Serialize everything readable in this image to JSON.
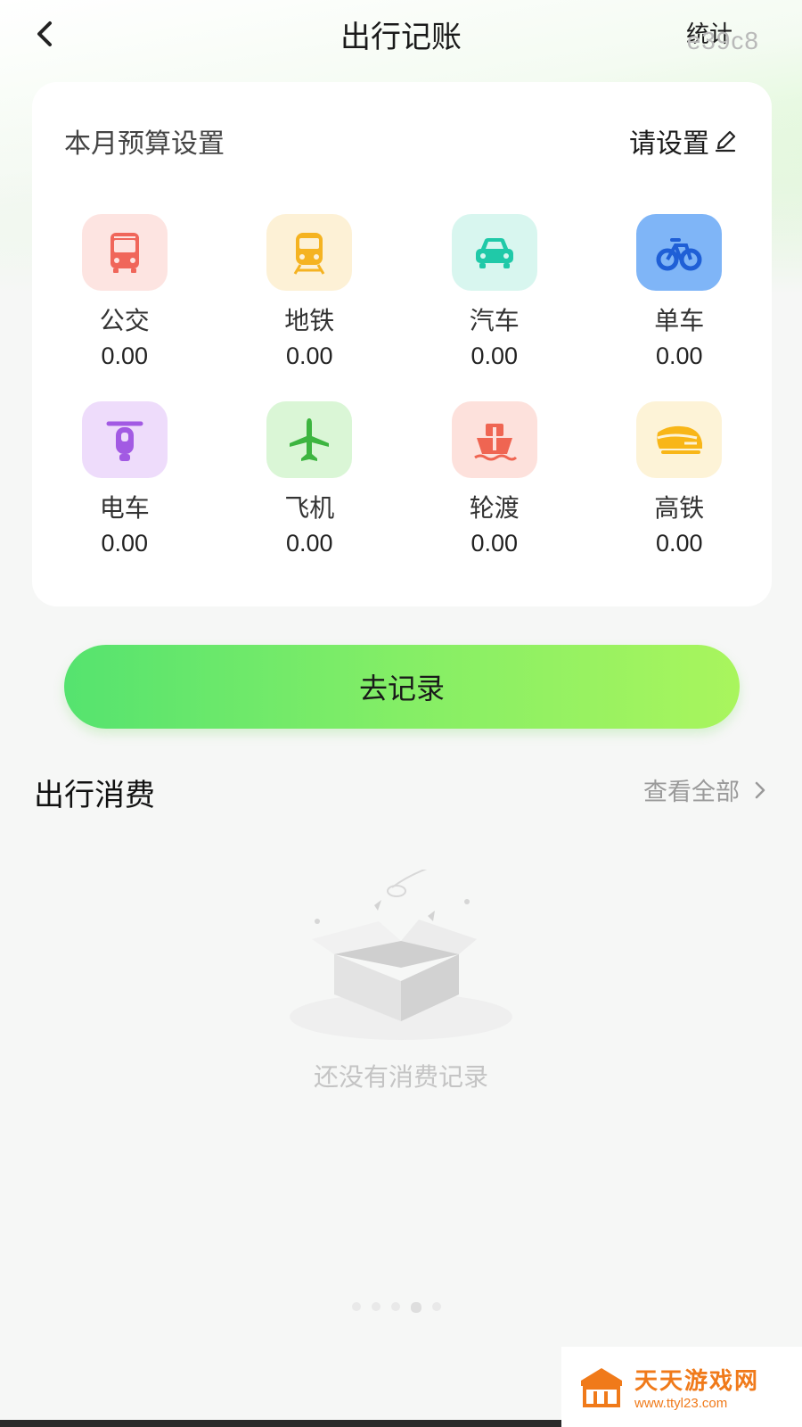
{
  "header": {
    "title": "出行记账",
    "stats_label": "统计",
    "overlay_code": "e39c8"
  },
  "budget": {
    "label": "本月预算设置",
    "set_label": "请设置"
  },
  "categories": [
    {
      "label": "公交",
      "value": "0.00",
      "icon": "bus-icon",
      "color": "#f0665a"
    },
    {
      "label": "地铁",
      "value": "0.00",
      "icon": "subway-icon",
      "color": "#f5b321"
    },
    {
      "label": "汽车",
      "value": "0.00",
      "icon": "car-icon",
      "color": "#20c9a8"
    },
    {
      "label": "单车",
      "value": "0.00",
      "icon": "bicycle-icon",
      "color": "#2f7df0"
    },
    {
      "label": "电车",
      "value": "0.00",
      "icon": "scooter-icon",
      "color": "#a25ae3"
    },
    {
      "label": "飞机",
      "value": "0.00",
      "icon": "airplane-icon",
      "color": "#4cc94a"
    },
    {
      "label": "轮渡",
      "value": "0.00",
      "icon": "ferry-icon",
      "color": "#ef6552"
    },
    {
      "label": "高铁",
      "value": "0.00",
      "icon": "high-speed-train-icon",
      "color": "#f8b618"
    }
  ],
  "record_button": "去记录",
  "section": {
    "title": "出行消费",
    "view_all": "查看全部"
  },
  "empty_state": "还没有消费记录",
  "watermark": {
    "name": "天天游戏网",
    "url": "www.ttyl23.com"
  }
}
